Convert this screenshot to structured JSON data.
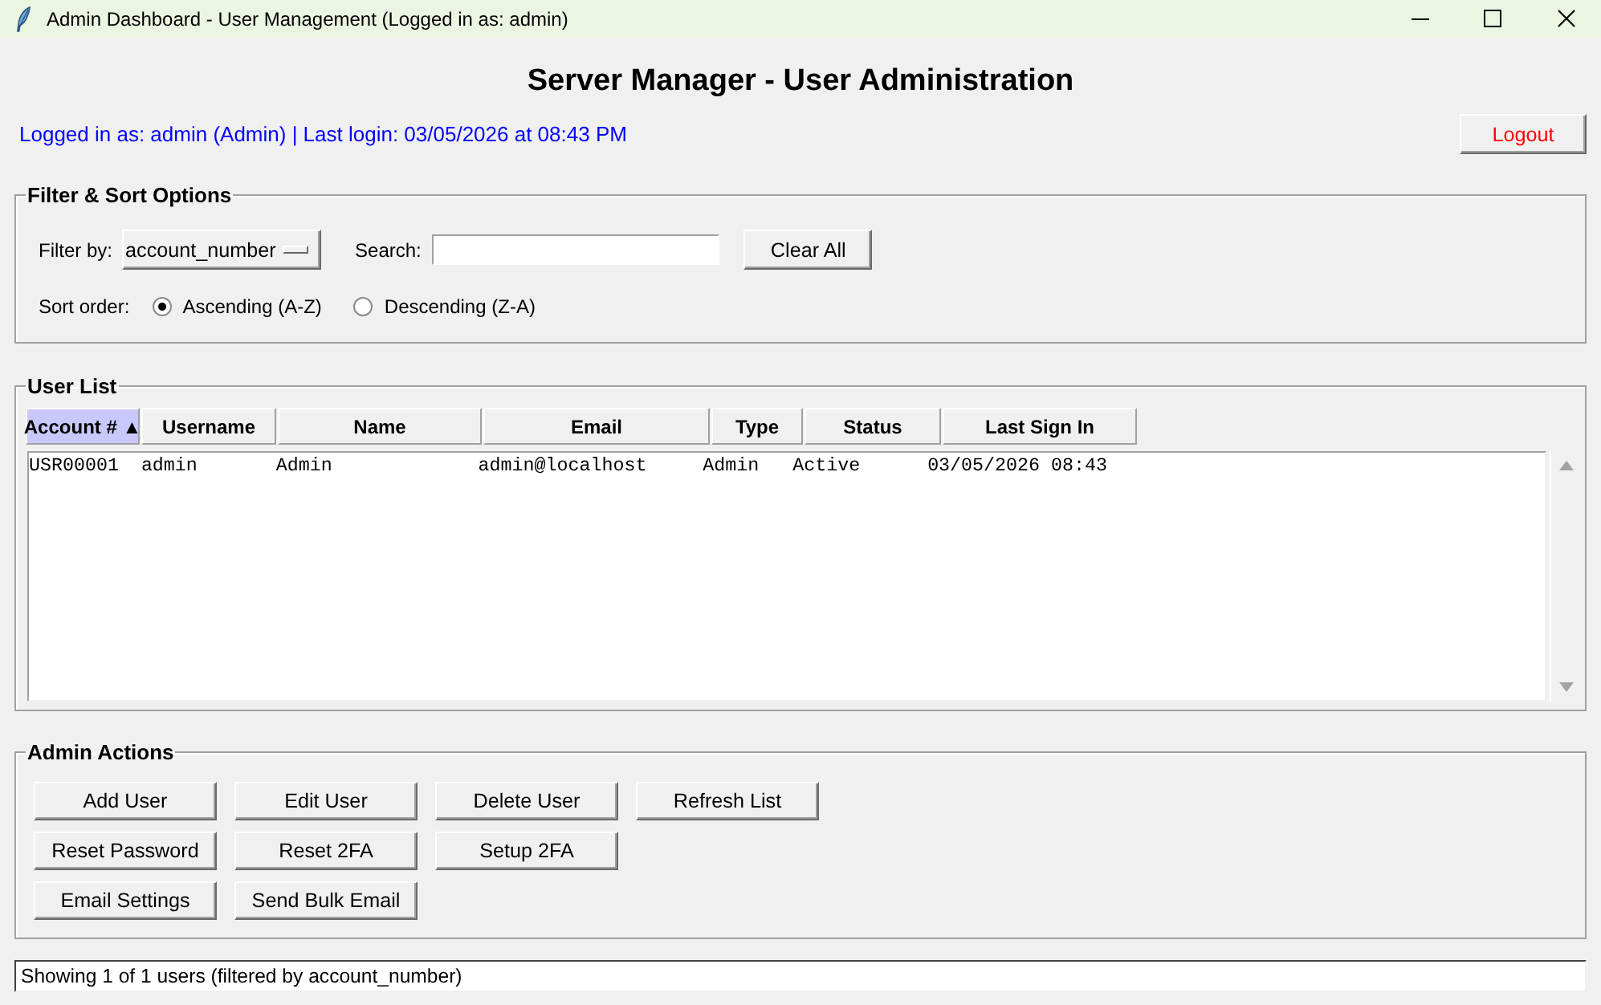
{
  "window": {
    "title": "Admin Dashboard - User Management (Logged in as: admin)"
  },
  "heading": "Server Manager - User Administration",
  "session_info": "Logged in as: admin (Admin) | Last login: 03/05/2026 at 08:43 PM",
  "logout_button": "Logout",
  "filter_sort": {
    "title": "Filter & Sort Options",
    "filter_label": "Filter by:",
    "filter_value": "account_number",
    "search_label": "Search:",
    "clear_button": "Clear All",
    "sort_label": "Sort order:",
    "sort_options": [
      {
        "label": "Ascending (A-Z)",
        "selected": true
      },
      {
        "label": "Descending (Z-A)",
        "selected": false
      }
    ]
  },
  "user_list": {
    "title": "User List",
    "columns": [
      {
        "label": "Account # ▲",
        "selected": true
      },
      {
        "label": "Username",
        "selected": false
      },
      {
        "label": "Name",
        "selected": false
      },
      {
        "label": "Email",
        "selected": false
      },
      {
        "label": "Type",
        "selected": false
      },
      {
        "label": "Status",
        "selected": false
      },
      {
        "label": "Last Sign In",
        "selected": false
      }
    ],
    "rows": [
      [
        "USR00001",
        "admin",
        "Admin",
        "admin@localhost",
        "Admin",
        "Active",
        "03/05/2026 08:43"
      ]
    ]
  },
  "admin_actions": {
    "title": "Admin Actions",
    "button_rows": [
      [
        "Add User",
        "Edit User",
        "Delete User",
        "Refresh List"
      ],
      [
        "Reset Password",
        "Reset 2FA",
        "Setup 2FA"
      ],
      [
        "Email Settings",
        "Send Bulk Email"
      ]
    ]
  },
  "status_bar": "Showing 1 of 1 users (filtered by account_number)"
}
